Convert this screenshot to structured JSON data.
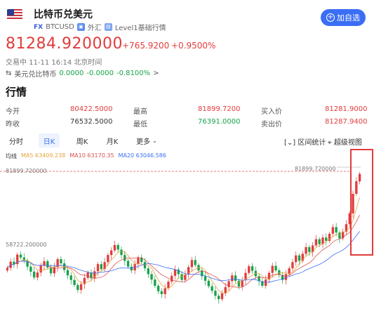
{
  "header": {
    "title": "比特币兑美元",
    "fx_badge": "FX",
    "symbol": "BTCUSD",
    "market_tag": "外汇",
    "level_tag": "Level1基础行情",
    "add_button": "加自选"
  },
  "quote": {
    "price": "81284.920000",
    "change": "+765.9200",
    "change_pct": "+0.9500%",
    "status": "交易中 11-11 16:14 北京时间",
    "cross_label": "美元兑比特币",
    "cross_price": "0.0000",
    "cross_change": "-0.0000",
    "cross_pct": "-0.8100%",
    "cross_arrow": ">"
  },
  "section_title": "行情",
  "stats": {
    "open_label": "今开",
    "open": "80422.5000",
    "prev_label": "昨收",
    "prev": "76532.5000",
    "high_label": "最高",
    "high": "81899.7200",
    "low_label": "最低",
    "low": "76391.0000",
    "bid_label": "买入价",
    "bid": "81281.9000",
    "ask_label": "卖出价",
    "ask": "81287.9400"
  },
  "tabs": [
    "分时",
    "日K",
    "周K",
    "月K",
    "更多"
  ],
  "active_tab": "日K",
  "tools": {
    "range_stat": "区间统计",
    "super_view": "超级视图"
  },
  "ma": {
    "label": "均线",
    "ma5": "MA5 63409.238",
    "ma10": "MA10 63170.35",
    "ma20": "MA20 63046.586"
  },
  "chart_data": {
    "type": "candlestick",
    "max_label": "81899.720000",
    "max_line_label": "81899.720000",
    "mid_label": "58722.200000",
    "colors": {
      "up": "#e23b3b",
      "down": "#17a34a",
      "ma5": "#e6a23c",
      "ma10": "#d9534f",
      "ma20": "#3b6ef5"
    },
    "closes": [
      58700,
      60200,
      59600,
      61900,
      61200,
      60500,
      59000,
      57800,
      56400,
      57600,
      59200,
      60300,
      58800,
      57400,
      58900,
      60800,
      59800,
      58200,
      56900,
      55800,
      54600,
      53400,
      54800,
      56300,
      57600,
      56200,
      57900,
      59600,
      58400,
      60100,
      61800,
      62900,
      64200,
      63100,
      61800,
      60400,
      59000,
      58100,
      59600,
      61200,
      60100,
      58600,
      57200,
      55900,
      54400,
      53100,
      52400,
      53800,
      55400,
      56800,
      58300,
      57200,
      55800,
      57100,
      58900,
      60600,
      59400,
      58100,
      56700,
      55600,
      54300,
      53200,
      52000,
      51200,
      52600,
      54100,
      55500,
      56900,
      55600,
      54200,
      55800,
      57500,
      59100,
      58000,
      56700,
      55500,
      54400,
      55900,
      57500,
      59200,
      58100,
      57000,
      55800,
      57200,
      58600,
      60100,
      61700,
      60400,
      62100,
      63700,
      62500,
      64100,
      65600,
      64400,
      66000,
      65200,
      66900,
      68500,
      67200,
      65800,
      67400,
      69200,
      71800,
      76500,
      79500,
      81284
    ]
  }
}
